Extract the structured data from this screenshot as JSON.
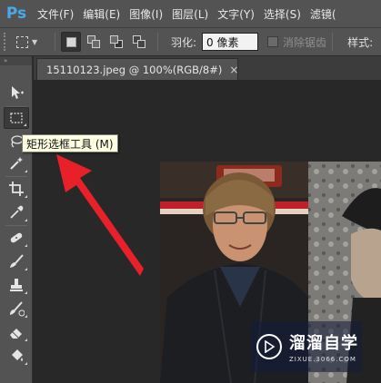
{
  "app": {
    "logo": "Ps"
  },
  "menu": {
    "items": [
      {
        "label": "文件(F)"
      },
      {
        "label": "编辑(E)"
      },
      {
        "label": "图像(I)"
      },
      {
        "label": "图层(L)"
      },
      {
        "label": "文字(Y)"
      },
      {
        "label": "选择(S)"
      },
      {
        "label": "滤镜("
      }
    ]
  },
  "options": {
    "feather_label": "羽化:",
    "feather_value": "0 像素",
    "antialias_label": "消除锯齿",
    "antialias_checked": false,
    "style_label": "样式:"
  },
  "toolbar": {
    "collapse_glyph": "»",
    "tools": [
      {
        "name": "move-tool",
        "icon": "move-icon",
        "selected": false
      },
      {
        "name": "rectangular-marquee-tool",
        "icon": "marquee-icon",
        "selected": true
      },
      {
        "name": "lasso-tool",
        "icon": "lasso-icon",
        "selected": false
      },
      {
        "name": "magic-wand-tool",
        "icon": "magic-wand-icon",
        "selected": false
      },
      {
        "name": "crop-tool",
        "icon": "crop-icon",
        "selected": false
      },
      {
        "name": "eyedropper-tool",
        "icon": "eyedropper-icon",
        "selected": false
      },
      {
        "name": "healing-brush-tool",
        "icon": "bandage-icon",
        "selected": false
      },
      {
        "name": "brush-tool",
        "icon": "brush-icon",
        "selected": false
      },
      {
        "name": "clone-stamp-tool",
        "icon": "stamp-icon",
        "selected": false
      },
      {
        "name": "history-brush-tool",
        "icon": "history-brush-icon",
        "selected": false
      },
      {
        "name": "eraser-tool",
        "icon": "eraser-icon",
        "selected": false
      },
      {
        "name": "paint-bucket-tool",
        "icon": "bucket-icon",
        "selected": false
      }
    ]
  },
  "document_tab": {
    "title": "15110123.jpeg @ 100%(RGB/8#)",
    "close_glyph": "×"
  },
  "tooltip": {
    "text": "矩形选框工具 (M)"
  },
  "watermark": {
    "brand": "溜溜自学",
    "url": "ZIXUE.3066.COM"
  },
  "colors": {
    "ui_panel": "#535353",
    "ui_dark": "#282828",
    "ps_blue": "#4aa8ea",
    "tooltip_bg": "#ffffe1",
    "annotation_arrow": "#e8202a"
  }
}
